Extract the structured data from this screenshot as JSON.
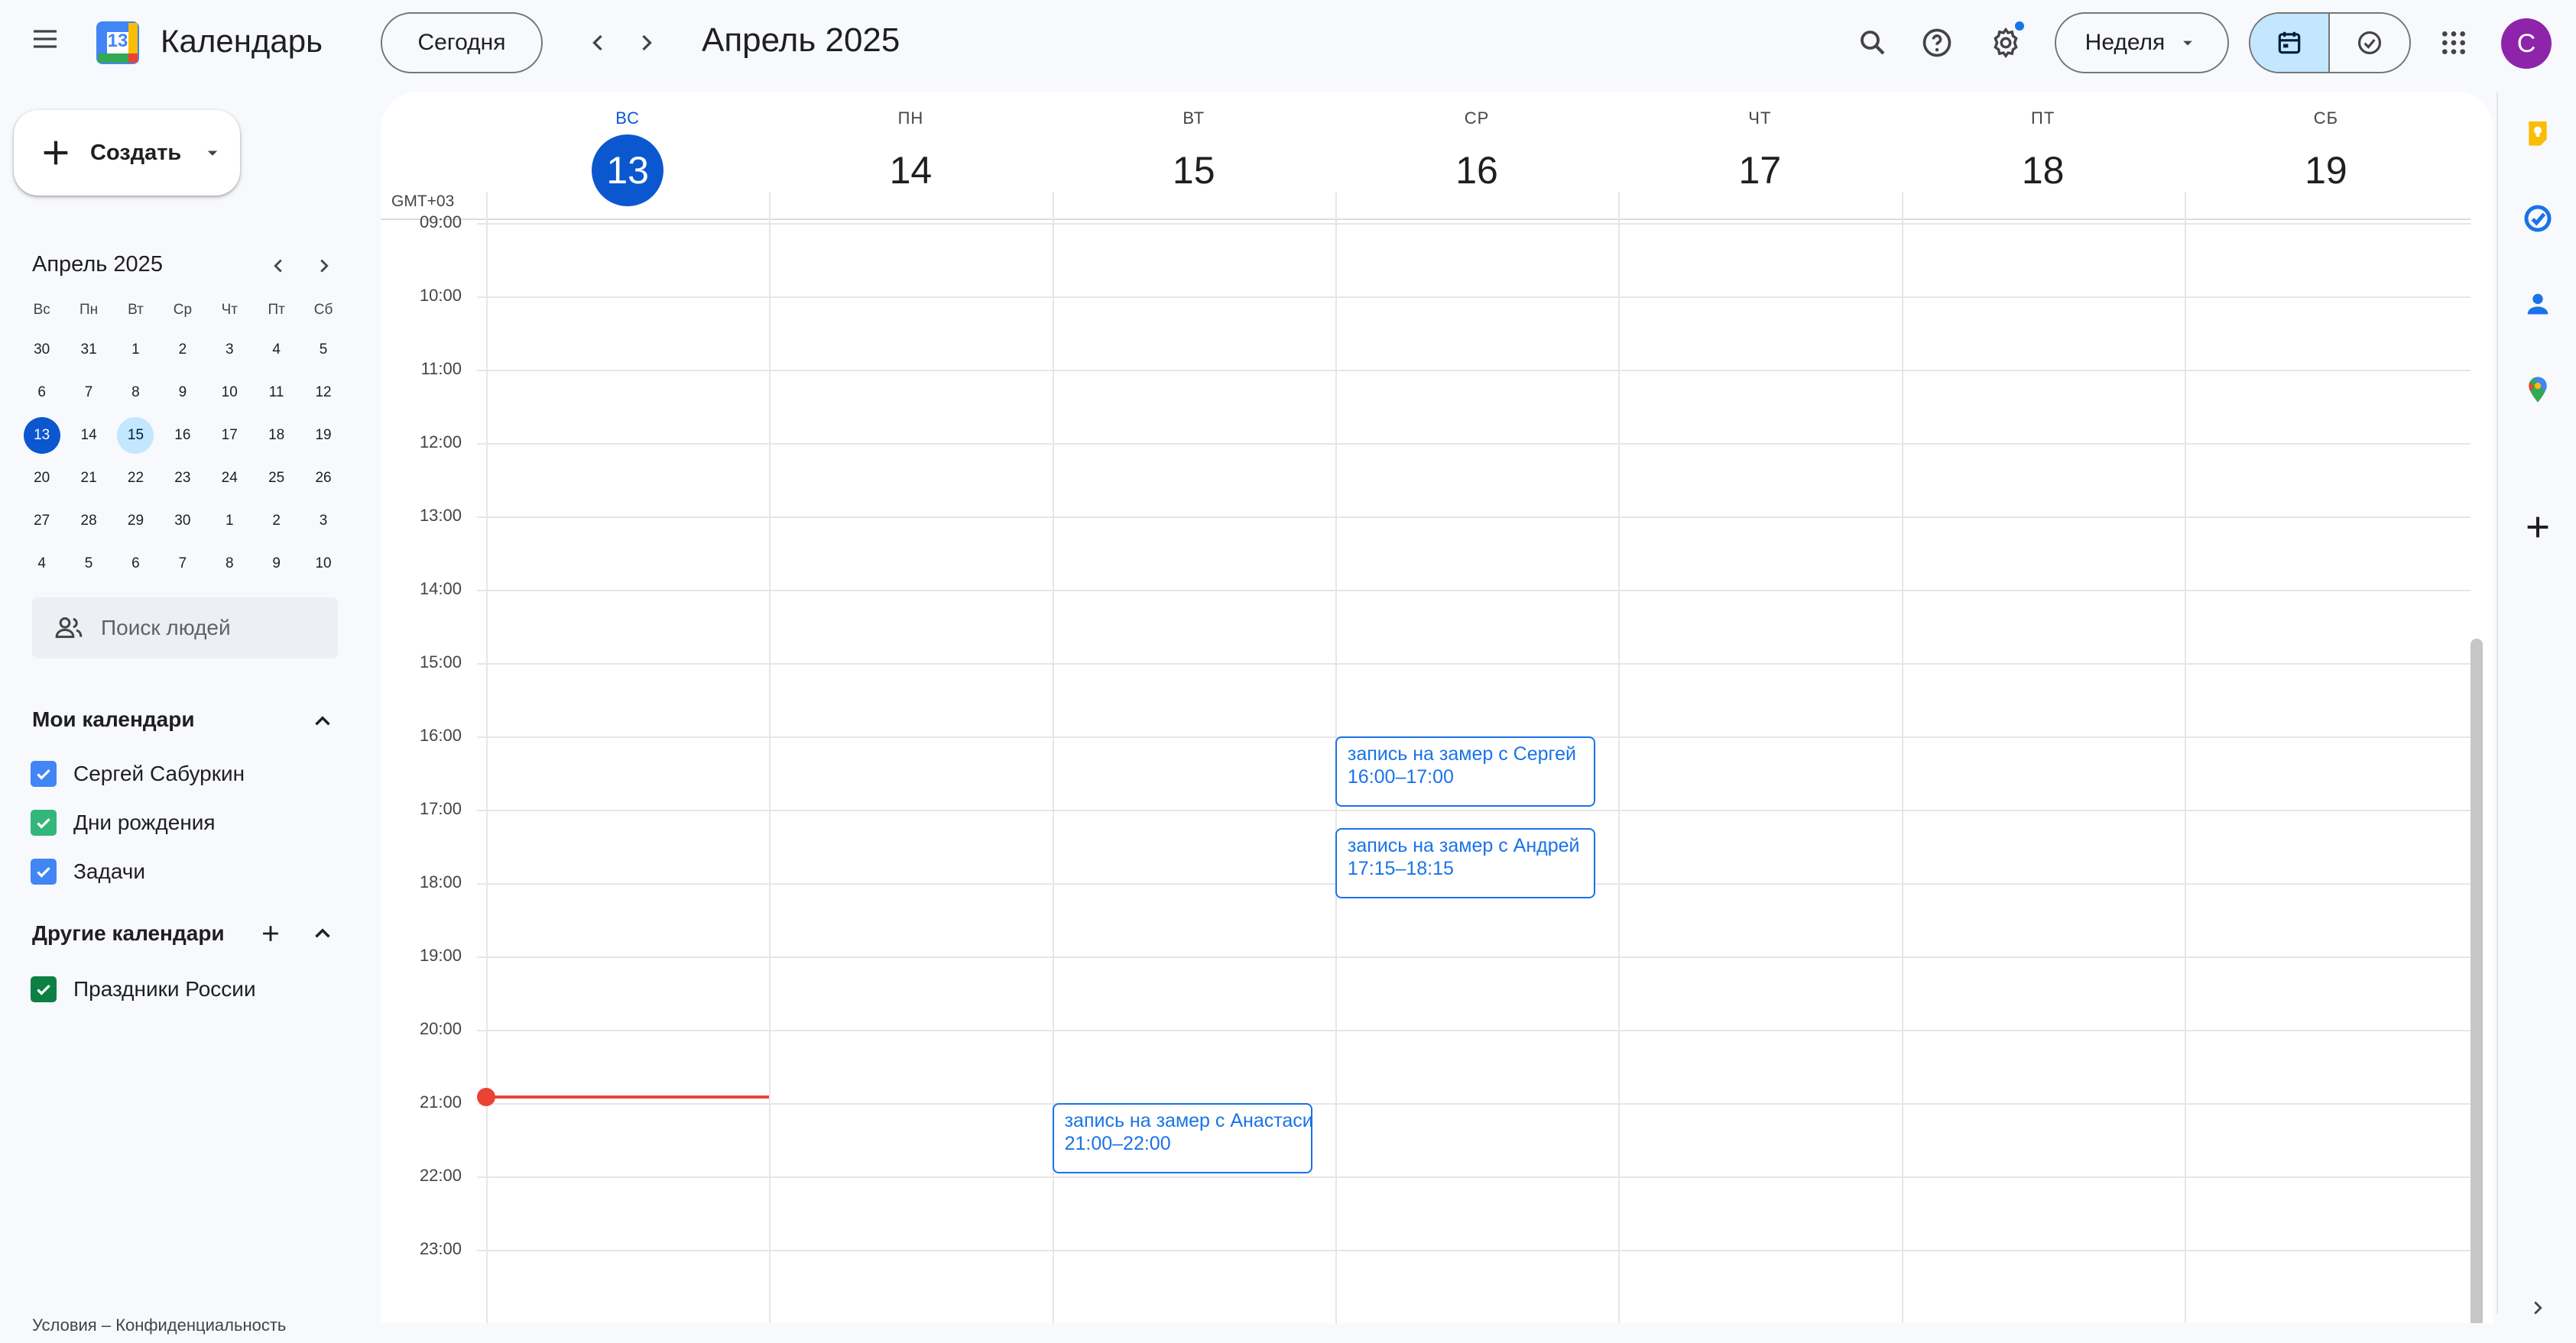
{
  "app": {
    "title": "Календарь",
    "logo_day": "13"
  },
  "toolbar": {
    "today_label": "Сегодня",
    "period_title": "Апрель 2025",
    "view_select": "Неделя",
    "avatar_letter": "С"
  },
  "create": {
    "label": "Создать"
  },
  "mini_calendar": {
    "title": "Апрель 2025",
    "weekdays": [
      "Вс",
      "Пн",
      "Вт",
      "Ср",
      "Чт",
      "Пт",
      "Сб"
    ],
    "weeks": [
      [
        "30",
        "31",
        "1",
        "2",
        "3",
        "4",
        "5"
      ],
      [
        "6",
        "7",
        "8",
        "9",
        "10",
        "11",
        "12"
      ],
      [
        "13",
        "14",
        "15",
        "16",
        "17",
        "18",
        "19"
      ],
      [
        "20",
        "21",
        "22",
        "23",
        "24",
        "25",
        "26"
      ],
      [
        "27",
        "28",
        "29",
        "30",
        "1",
        "2",
        "3"
      ],
      [
        "4",
        "5",
        "6",
        "7",
        "8",
        "9",
        "10"
      ]
    ],
    "today": "13",
    "selected": "15"
  },
  "people_search": {
    "placeholder": "Поиск людей"
  },
  "my_calendars": {
    "title": "Мои календари",
    "items": [
      {
        "label": "Сергей Сабуркин",
        "color": "#4285f4"
      },
      {
        "label": "Дни рождения",
        "color": "#33b679"
      },
      {
        "label": "Задачи",
        "color": "#4285f4"
      }
    ]
  },
  "other_calendars": {
    "title": "Другие календари",
    "items": [
      {
        "label": "Праздники России",
        "color": "#0b8043"
      }
    ]
  },
  "footer": {
    "terms": "Условия",
    "sep": "–",
    "privacy": "Конфиденциальность"
  },
  "week": {
    "timezone": "GMT+03",
    "days": [
      {
        "dow": "ВС",
        "num": "13",
        "today": true
      },
      {
        "dow": "ПН",
        "num": "14"
      },
      {
        "dow": "ВТ",
        "num": "15"
      },
      {
        "dow": "СР",
        "num": "16"
      },
      {
        "dow": "ЧТ",
        "num": "17"
      },
      {
        "dow": "ПТ",
        "num": "18"
      },
      {
        "dow": "СБ",
        "num": "19"
      }
    ],
    "hours": [
      "09:00",
      "10:00",
      "11:00",
      "12:00",
      "13:00",
      "14:00",
      "15:00",
      "16:00",
      "17:00",
      "18:00",
      "19:00",
      "20:00",
      "21:00",
      "22:00",
      "23:00"
    ],
    "current_time": "21:00",
    "events": [
      {
        "title": "запись на замер с Сергей",
        "time": "16:00–17:00",
        "day": "СР"
      },
      {
        "title": "запись на замер с Андрей",
        "time": "17:15–18:15",
        "day": "СР"
      },
      {
        "title": "запись на замер с Анастасией",
        "time": "21:00–22:00",
        "day": "ВТ"
      }
    ]
  },
  "colors": {
    "accent": "#0b57d0",
    "event": "#1a73e8",
    "now_line": "#ea4335",
    "selected_view": "#c2e7ff"
  },
  "side_panel_icons": [
    "keep-icon",
    "tasks-icon",
    "contacts-icon",
    "maps-icon",
    "add-icon"
  ]
}
